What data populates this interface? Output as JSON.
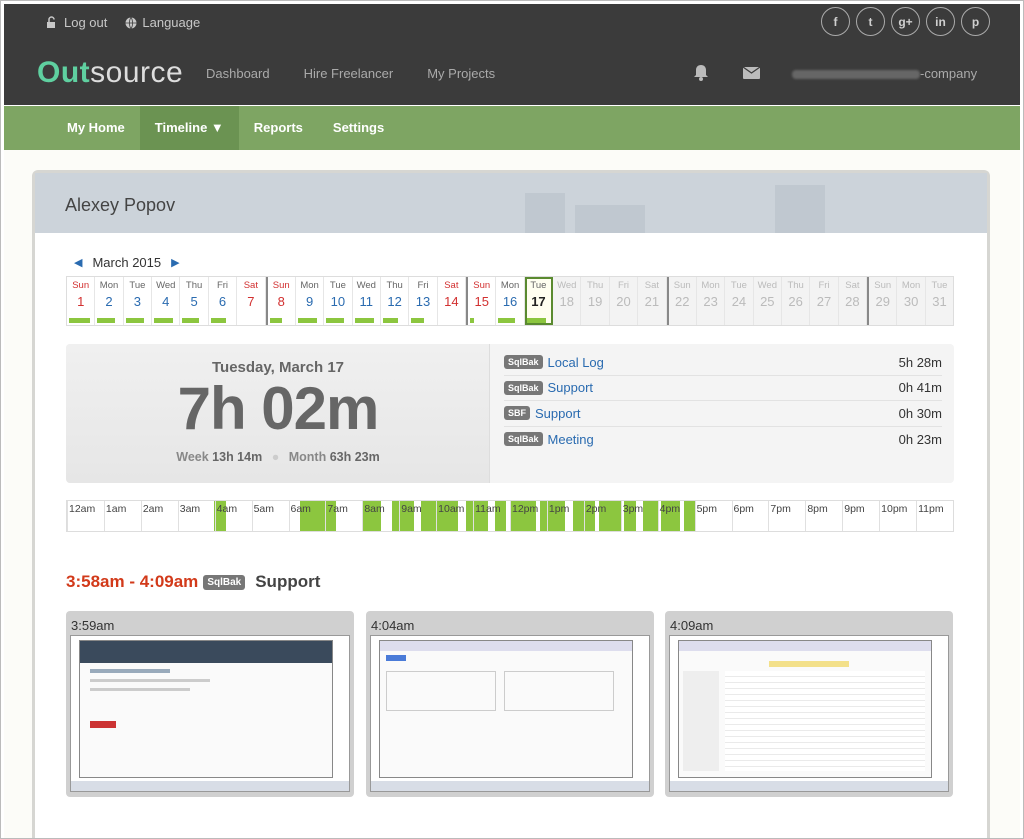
{
  "topbar": {
    "logout": "Log out",
    "language": "Language",
    "social": [
      "f",
      "t",
      "g+",
      "in",
      "p"
    ]
  },
  "logo": {
    "part1": "Out",
    "part2": "source"
  },
  "mainnav": [
    "Dashboard",
    "Hire Freelancer",
    "My Projects"
  ],
  "company_suffix": "-company",
  "greennav": [
    {
      "label": "My Home",
      "active": false
    },
    {
      "label": "Timeline ▼",
      "active": true
    },
    {
      "label": "Reports",
      "active": false
    },
    {
      "label": "Settings",
      "active": false
    }
  ],
  "user_name": "Alexey Popov",
  "month_label": "March 2015",
  "calendar": {
    "days": [
      {
        "dn": "Sun",
        "d": "1",
        "worked": 0.9
      },
      {
        "dn": "Mon",
        "d": "2",
        "worked": 0.8
      },
      {
        "dn": "Tue",
        "d": "3",
        "worked": 0.8
      },
      {
        "dn": "Wed",
        "d": "4",
        "worked": 0.85
      },
      {
        "dn": "Thu",
        "d": "5",
        "worked": 0.75
      },
      {
        "dn": "Fri",
        "d": "6",
        "worked": 0.7
      },
      {
        "dn": "Sat",
        "d": "7",
        "worked": 0
      },
      {
        "dn": "Sun",
        "d": "8",
        "worked": 0.6
      },
      {
        "dn": "Mon",
        "d": "9",
        "worked": 0.85
      },
      {
        "dn": "Tue",
        "d": "10",
        "worked": 0.8
      },
      {
        "dn": "Wed",
        "d": "11",
        "worked": 0.85
      },
      {
        "dn": "Thu",
        "d": "12",
        "worked": 0.7
      },
      {
        "dn": "Fri",
        "d": "13",
        "worked": 0.6
      },
      {
        "dn": "Sat",
        "d": "14",
        "worked": 0
      },
      {
        "dn": "Sun",
        "d": "15",
        "worked": 0.3
      },
      {
        "dn": "Mon",
        "d": "16",
        "worked": 0.75
      },
      {
        "dn": "Tue",
        "d": "17",
        "worked": 0.85
      },
      {
        "dn": "Wed",
        "d": "18",
        "worked": 0
      },
      {
        "dn": "Thu",
        "d": "19",
        "worked": 0
      },
      {
        "dn": "Fri",
        "d": "20",
        "worked": 0
      },
      {
        "dn": "Sat",
        "d": "21",
        "worked": 0
      },
      {
        "dn": "Sun",
        "d": "22",
        "worked": 0
      },
      {
        "dn": "Mon",
        "d": "23",
        "worked": 0
      },
      {
        "dn": "Tue",
        "d": "24",
        "worked": 0
      },
      {
        "dn": "Wed",
        "d": "25",
        "worked": 0
      },
      {
        "dn": "Thu",
        "d": "26",
        "worked": 0
      },
      {
        "dn": "Fri",
        "d": "27",
        "worked": 0
      },
      {
        "dn": "Sat",
        "d": "28",
        "worked": 0
      },
      {
        "dn": "Sun",
        "d": "29",
        "worked": 0
      },
      {
        "dn": "Mon",
        "d": "30",
        "worked": 0
      },
      {
        "dn": "Tue",
        "d": "31",
        "worked": 0
      }
    ],
    "today_index": 16
  },
  "summary": {
    "date": "Tuesday, March 17",
    "total": "7h 02m",
    "week_label": "Week",
    "week_value": "13h 14m",
    "month_label": "Month",
    "month_value": "63h 23m",
    "rows": [
      {
        "badge": "SqlBak",
        "label": "Local Log",
        "time": "5h 28m"
      },
      {
        "badge": "SqlBak",
        "label": "Support",
        "time": "0h 41m"
      },
      {
        "badge": "SBF",
        "label": "Support",
        "time": "0h 30m"
      },
      {
        "badge": "SqlBak",
        "label": "Meeting",
        "time": "0h 23m"
      }
    ]
  },
  "hours": {
    "labels": [
      "12am",
      "1am",
      "2am",
      "3am",
      "4am",
      "5am",
      "6am",
      "7am",
      "8am",
      "9am",
      "10am",
      "11am",
      "12pm",
      "1pm",
      "2pm",
      "3pm",
      "4pm",
      "5pm",
      "6pm",
      "7pm",
      "8pm",
      "9pm",
      "10pm",
      "11pm"
    ],
    "active_ranges": [
      [
        3.97,
        4.3
      ],
      [
        6.3,
        7.3
      ],
      [
        8.0,
        8.5
      ],
      [
        8.8,
        9.4
      ],
      [
        9.6,
        10.1
      ],
      [
        10.1,
        10.6
      ],
      [
        10.8,
        11.4
      ],
      [
        11.6,
        11.9
      ],
      [
        12.0,
        12.7
      ],
      [
        12.8,
        13.5
      ],
      [
        13.7,
        14.3
      ],
      [
        14.4,
        15.0
      ],
      [
        15.1,
        15.4
      ],
      [
        15.6,
        16.0
      ],
      [
        16.1,
        16.6
      ],
      [
        16.7,
        17.0
      ]
    ]
  },
  "session": {
    "range": "3:58am - 4:09am",
    "badge": "SqlBak",
    "label": "Support",
    "shots": [
      "3:59am",
      "4:04am",
      "4:09am"
    ]
  },
  "colors": {
    "accent_green": "#7ea563",
    "link": "#2a6bb0",
    "red": "#d23030",
    "bar": "#8cc63f"
  }
}
